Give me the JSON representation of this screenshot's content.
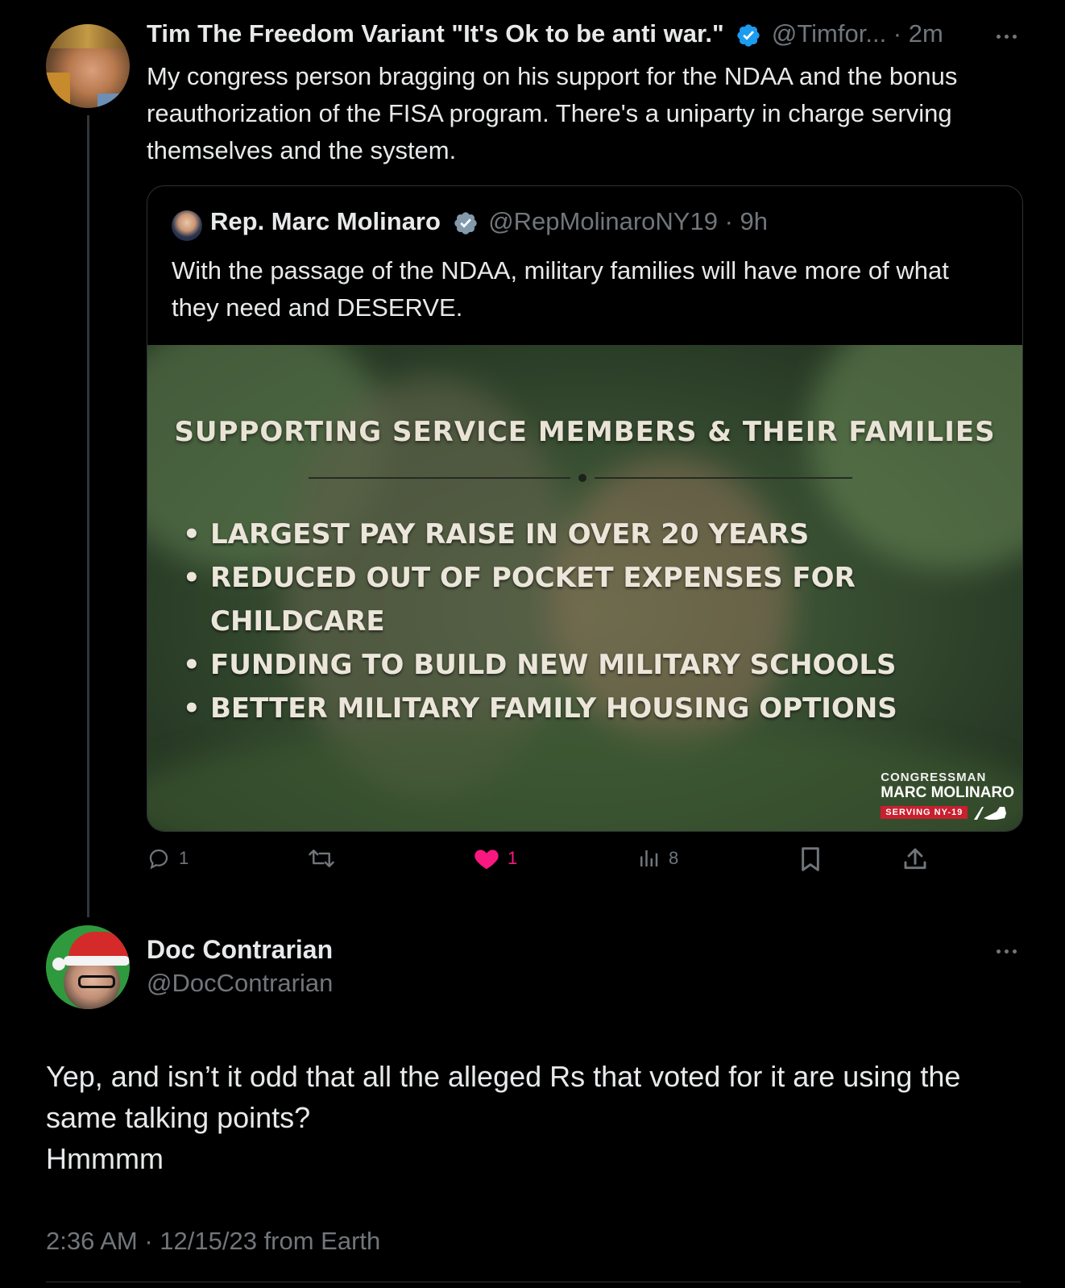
{
  "main_tweet": {
    "display_name": "Tim The Freedom Variant \"It's Ok to be anti war.\"",
    "handle_time": "@Timfor... · 2m",
    "text": "My congress person bragging on his support for the NDAA and the bonus reauthorization of the FISA program. There's a uniparty in charge serving themselves and the system."
  },
  "quoted_tweet": {
    "display_name": "Rep. Marc Molinaro",
    "handle": "@RepMolinaroNY19",
    "time": "· 9h",
    "text": "With the passage of the NDAA, military families will have more of what they need and DESERVE.",
    "image": {
      "title": "SUPPORTING SERVICE MEMBERS & THEIR FAMILIES",
      "bullets": [
        "LARGEST PAY RAISE IN OVER 20 YEARS",
        "REDUCED OUT OF POCKET EXPENSES FOR CHILDCARE",
        "FUNDING TO BUILD NEW MILITARY SCHOOLS",
        "BETTER MILITARY FAMILY HOUSING OPTIONS"
      ],
      "logo_line1": "CONGRESSMAN",
      "logo_line2": "MARC MOLINARO",
      "logo_line3": "SERVING NY-19"
    }
  },
  "actions": {
    "reply_count": "1",
    "retweet_count": "",
    "like_count": "1",
    "views_count": "8"
  },
  "reply": {
    "display_name": "Doc Contrarian",
    "handle": "@DocContrarian",
    "text_line1": "Yep, and isn’t it odd that all the alleged Rs that voted for it are using the",
    "text_line2": "same talking points?",
    "text_line3": "Hmmmm",
    "timestamp": "2:36 AM · 12/15/23 from Earth"
  },
  "colors": {
    "background": "#000000",
    "text": "#e7e9ea",
    "muted": "#71767b",
    "verified_blue": "#1d9bf0",
    "verified_gray": "#829aab",
    "like_pink": "#f91880"
  }
}
